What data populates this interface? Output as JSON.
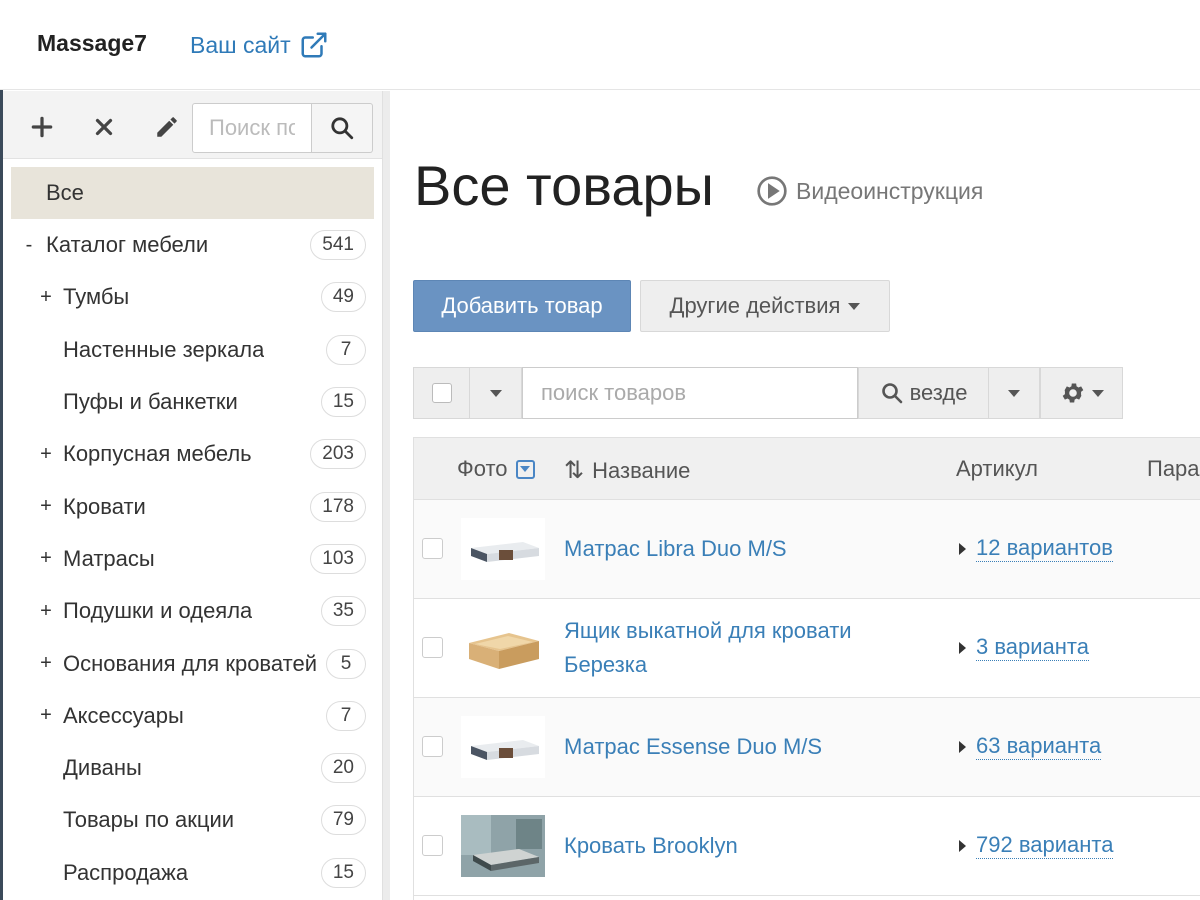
{
  "header": {
    "brand": "Massage7",
    "site_link": "Ваш сайт"
  },
  "sidebar": {
    "search_placeholder": "Поиск по категориям",
    "items": [
      {
        "label": "Все",
        "toggle": "",
        "count": "",
        "level": 0,
        "active": true
      },
      {
        "label": "Каталог мебели",
        "toggle": "-",
        "count": "541",
        "level": 0
      },
      {
        "label": "Тумбы",
        "toggle": "+",
        "count": "49",
        "level": 1
      },
      {
        "label": "Настенные зеркала",
        "toggle": "",
        "count": "7",
        "level": 1
      },
      {
        "label": "Пуфы и банкетки",
        "toggle": "",
        "count": "15",
        "level": 1
      },
      {
        "label": "Корпусная мебель",
        "toggle": "+",
        "count": "203",
        "level": 1
      },
      {
        "label": "Кровати",
        "toggle": "+",
        "count": "178",
        "level": 1
      },
      {
        "label": "Матрасы",
        "toggle": "+",
        "count": "103",
        "level": 1
      },
      {
        "label": "Подушки и одеяла",
        "toggle": "+",
        "count": "35",
        "level": 1
      },
      {
        "label": "Основания для кроватей",
        "toggle": "+",
        "count": "5",
        "level": 1
      },
      {
        "label": "Аксессуары",
        "toggle": "+",
        "count": "7",
        "level": 1
      },
      {
        "label": "Диваны",
        "toggle": "",
        "count": "20",
        "level": 1
      },
      {
        "label": "Товары по акции",
        "toggle": "",
        "count": "79",
        "level": 1
      },
      {
        "label": "Распродажа",
        "toggle": "",
        "count": "15",
        "level": 1
      }
    ]
  },
  "main": {
    "title": "Все товары",
    "video_link": "Видеоинструкция",
    "add_button": "Добавить товар",
    "other_actions": "Другие действия",
    "search_placeholder": "поиск товаров",
    "search_scope": "везде",
    "columns": {
      "photo": "Фото",
      "name": "Название",
      "sku": "Артикул",
      "params": "Пара"
    },
    "products": [
      {
        "name": "Матрас Libra Duo M/S",
        "variants": "12 вариантов",
        "thumb": "mattress"
      },
      {
        "name": "Ящик выкатной для кровати Березка",
        "variants": "3 варианта",
        "thumb": "box"
      },
      {
        "name": "Матрас Essense Duo M/S",
        "variants": "63 варианта",
        "thumb": "mattress"
      },
      {
        "name": "Кровать Brooklyn",
        "variants": "792 варианта",
        "thumb": "bed"
      }
    ]
  },
  "colors": {
    "accent": "#3a7fb7",
    "primary_button": "#6a93c2",
    "active_category": "#e8e4da"
  }
}
